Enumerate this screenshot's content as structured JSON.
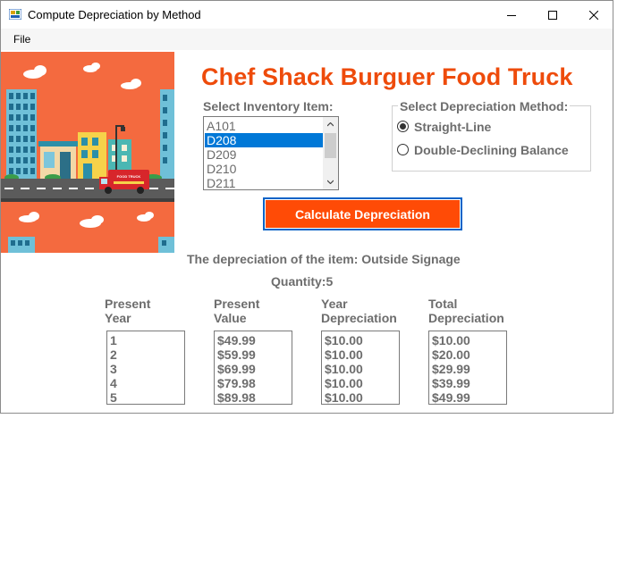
{
  "window": {
    "title": "Compute Depreciation by Method",
    "menu": [
      "File"
    ]
  },
  "header": {
    "app_title": "Chef Shack Burguer Food Truck",
    "banner_sign": "FOOD TRUCK"
  },
  "inventory": {
    "label": "Select Inventory Item:",
    "items": [
      "A101",
      "D208",
      "D209",
      "D210",
      "D211"
    ],
    "selected": "D208"
  },
  "method": {
    "legend": "Select Depreciation Method:",
    "options": [
      "Straight-Line",
      "Double-Declining Balance"
    ],
    "selected": "Straight-Line"
  },
  "actions": {
    "calculate_label": "Calculate Depreciation"
  },
  "result": {
    "description": "The depreciation of the item: Outside Signage",
    "quantity": "Quantity:5"
  },
  "table": {
    "headers": [
      [
        "Present",
        "Year"
      ],
      [
        "Present",
        "Value"
      ],
      [
        "Year",
        "Depreciation"
      ],
      [
        "Total",
        "Depreciation"
      ]
    ],
    "columns": [
      [
        "1",
        "2",
        "3",
        "4",
        "5"
      ],
      [
        "$49.99",
        "$59.99",
        "$69.99",
        "$79.98",
        "$89.98"
      ],
      [
        "$10.00",
        "$10.00",
        "$10.00",
        "$10.00",
        "$10.00"
      ],
      [
        "$10.00",
        "$20.00",
        "$29.99",
        "$39.99",
        "$49.99"
      ]
    ]
  },
  "colors": {
    "accent_orange": "#ee4b0b",
    "button_orange": "#ff4b06",
    "selection_blue": "#0078d7",
    "banner_bg": "#f46a3f"
  }
}
